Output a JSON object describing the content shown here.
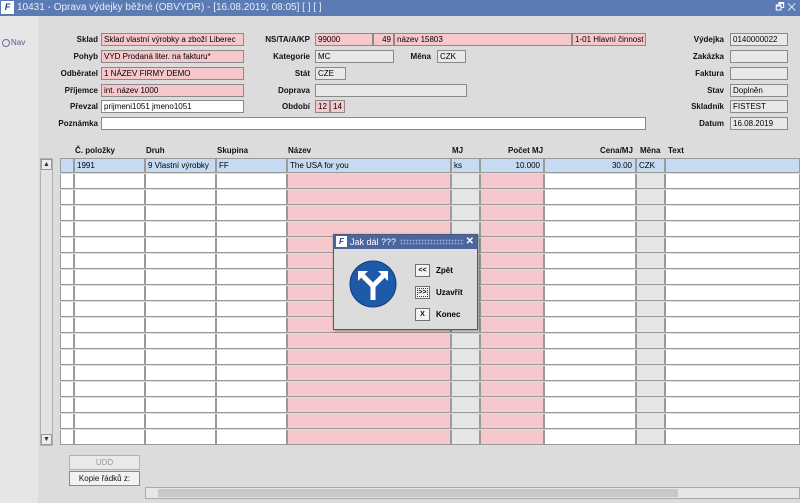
{
  "window": {
    "title": "10431 - Oprava výdejky běžné (OBVYDR) - [16.08.2019; 08:05]  [ ]  [ ]",
    "app_icon": "F"
  },
  "nav": {
    "label": "Nav"
  },
  "form": {
    "sklad_label": "Sklad",
    "sklad_value": "Sklad vlastní výrobky a zboží Liberec",
    "pohyb_label": "Pohyb",
    "pohyb_value": "VYD Prodaná liter. na fakturu*",
    "odberatel_label": "Odběratel",
    "odberatel_value": "1 NÁZEV FIRMY DEMO",
    "prijemce_label": "Příjemce",
    "prijemce_value": "int. název 1000",
    "prevzal_label": "Převzal",
    "prevzal_value": "prijmeni1051 jmeno1051",
    "poznamka_label": "Poznámka",
    "poznamka_value": "",
    "ns_label": "NS/TA/A/KP",
    "ns_value": "99000",
    "ns_num": "49",
    "ns_name": "název 15803",
    "ns_cinnost": "1-01 Hlavní činnost",
    "kategorie_label": "Kategorie",
    "kategorie_value": "MC",
    "mena_label": "Měna",
    "mena_value": "CZK",
    "stat_label": "Stát",
    "stat_value": "CZE",
    "doprava_label": "Doprava",
    "doprava_value": "",
    "obdobi_label": "Období",
    "obdobi_month": "12",
    "obdobi_num": "14",
    "vydejka_label": "Výdejka",
    "vydejka_value": "0140000022",
    "zakazka_label": "Zakázka",
    "zakazka_value": "",
    "faktura_label": "Faktura",
    "faktura_value": "",
    "stav_label": "Stav",
    "stav_value": "Doplněn",
    "skladnik_label": "Skladník",
    "skladnik_value": "FISTEST",
    "datum_label": "Datum",
    "datum_value": "16.08.2019"
  },
  "grid": {
    "headers": {
      "cpolozky": "Č. položky",
      "druh": "Druh",
      "skupina": "Skupina",
      "nazev": "Název",
      "mj": "MJ",
      "pocet": "Počet MJ",
      "cena": "Cena/MJ",
      "mena": "Měna",
      "text": "Text"
    },
    "rows": [
      {
        "cpolozky": "1991",
        "druh": "9 Vlastní výrobky",
        "skupina": "FF",
        "nazev": "The USA for you",
        "mj": "ks",
        "pocet": "10.000",
        "cena": "30.00",
        "mena": "CZK",
        "text": ""
      }
    ],
    "empty_row_count": 18
  },
  "buttons": {
    "udd": "UDD",
    "kopie": "Kopie řádků z:"
  },
  "dialog": {
    "title": "Jak dál ???",
    "back_symbol": "<<",
    "back_label": "Zpět",
    "close_symbol": ">>",
    "close_label": "Uzavřít",
    "end_symbol": "X",
    "end_label": "Konec",
    "sign_icon": "direction-sign-icon",
    "sign_color": "#1e5aa8"
  },
  "colors": {
    "titlebar": "#5b7bb4",
    "required_field": "#f6c8cc",
    "selected_row": "#c6daf1"
  }
}
